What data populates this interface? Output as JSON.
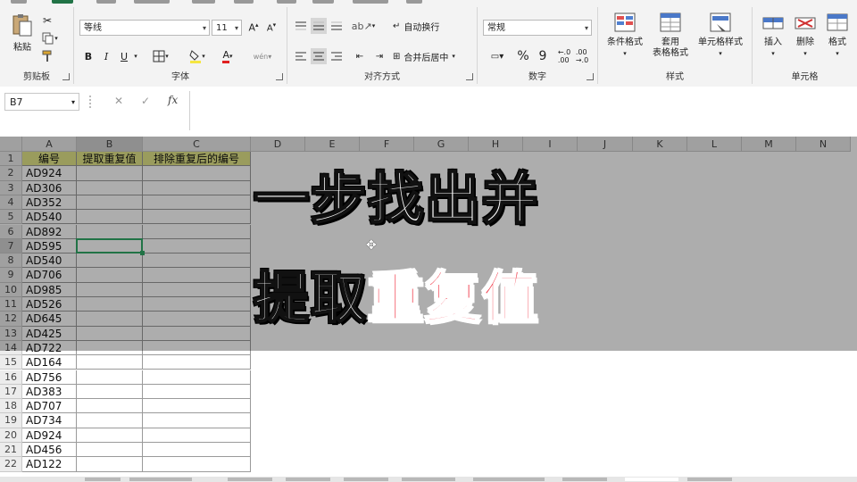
{
  "ribbon": {
    "clipboard": {
      "group_label": "剪贴板",
      "paste_label": "粘贴"
    },
    "font": {
      "group_label": "字体",
      "font_name": "等线",
      "font_size": "11",
      "bold": "B",
      "italic": "I",
      "underline": "U"
    },
    "alignment": {
      "group_label": "对齐方式",
      "wrap_text": "自动换行",
      "merge_center": "合并后居中"
    },
    "number": {
      "group_label": "数字",
      "format": "常规",
      "percent": "%",
      "comma": "9"
    },
    "styles": {
      "group_label": "样式",
      "conditional": "条件格式",
      "table_1": "套用",
      "table_2": "表格格式",
      "cell_styles": "单元格样式"
    },
    "cells": {
      "group_label": "单元格",
      "insert": "插入",
      "delete": "删除",
      "format": "格式"
    }
  },
  "formula_bar": {
    "name_box": "B7",
    "cancel": "✕",
    "enter": "✓",
    "fx": "fx",
    "value": ""
  },
  "columns": [
    "A",
    "B",
    "C",
    "D",
    "E",
    "F",
    "G",
    "H",
    "I",
    "J",
    "K",
    "L",
    "M",
    "N"
  ],
  "rows": [
    "1",
    "2",
    "3",
    "4",
    "5",
    "6",
    "7",
    "8",
    "9",
    "10",
    "11",
    "12",
    "13",
    "14",
    "15",
    "16",
    "17",
    "18",
    "19",
    "20",
    "21",
    "22"
  ],
  "headers": {
    "a": "编号",
    "b": "提取重复值",
    "c": "排除重复后的编号"
  },
  "codes": [
    "AD924",
    "AD306",
    "AD352",
    "AD540",
    "AD892",
    "AD595",
    "AD540",
    "AD706",
    "AD985",
    "AD526",
    "AD645",
    "AD425",
    "AD722",
    "AD164",
    "AD756",
    "AD383",
    "AD707",
    "AD734",
    "AD924",
    "AD456",
    "AD122"
  ],
  "caption": {
    "line1": "一步找出并",
    "line2a": "提取",
    "line2b": "重复值"
  },
  "colors": {
    "accent": "#217346",
    "caption_red": "#f03040",
    "header_fill": "#e3e68a"
  }
}
